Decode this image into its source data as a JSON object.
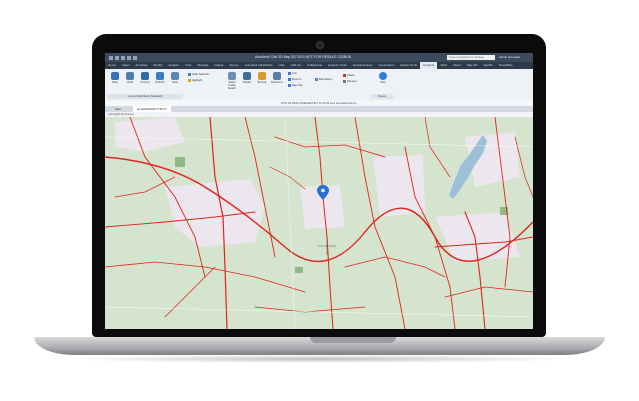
{
  "app": {
    "title": "Autodesk Civil 3D Map 3D 2019  NOT FOR RESALE  CS3BU8",
    "search_placeholder": "Type a keyword or phrase",
    "user": "admin.autodesk"
  },
  "menu_tabs": [
    "Home",
    "Insert",
    "Annotate",
    "Modify",
    "Analyze",
    "View",
    "Manage",
    "Output",
    "Survey",
    "Autodesk InfraWorks",
    "Help",
    "Add-ins",
    "Collaborate",
    "Express Tools",
    "Featured Apps",
    "Geolocation",
    "Raster Tools",
    "Connect",
    "Vault",
    "Vision",
    "Map 3D",
    "Nav3D",
    "SmartMap"
  ],
  "active_menu_tab": "Connect",
  "ribbon": {
    "buttons": [
      {
        "label": "Scan",
        "color": "#3b73b9"
      },
      {
        "label": "Undo",
        "color": "#4f7fb0"
      },
      {
        "label": "Commit",
        "color": "#2f6aa8"
      },
      {
        "label": "Refresh",
        "color": "#3a7bc2"
      },
      {
        "label": "Save",
        "color": "#5a86b8"
      }
    ],
    "small_items": [
      "Clear Selection",
      "Highlight"
    ],
    "buttons2": [
      {
        "label": "Select Inside Search",
        "color": "#6c8fb5"
      },
      {
        "label": "Details",
        "color": "#3e6e9e"
      },
      {
        "label": "Browse",
        "color": "#d89a2a"
      },
      {
        "label": "Edit Items",
        "color": "#5b7ea6"
      }
    ],
    "small_items2": [
      "Link",
      "Zoom to",
      "Map Tips"
    ],
    "small_items3": [
      "Edit History"
    ],
    "small_items4": [
      "Delete",
      "Remove"
    ],
    "help_label": "Help",
    "group_label_1": "Connect Edit Mode (Standard)",
    "group_label_2": "Panels"
  },
  "command_line": "RTS  Toll  NASS  QA&E  RES  RLT  A1 15:20  view annotation item(s)",
  "doc_tabs": [
    "Start",
    "area0000000077700.D*"
  ],
  "active_doc_tab": 1,
  "viewport_label": "[-][Top][2D Wireframe]",
  "colors": {
    "road_red": "#e2231a",
    "water": "#9cc0d8",
    "urban": "#ece6ee",
    "map_bg": "#d4e4ce",
    "forest": "#8fb985",
    "pin": "#2a6fd6"
  }
}
